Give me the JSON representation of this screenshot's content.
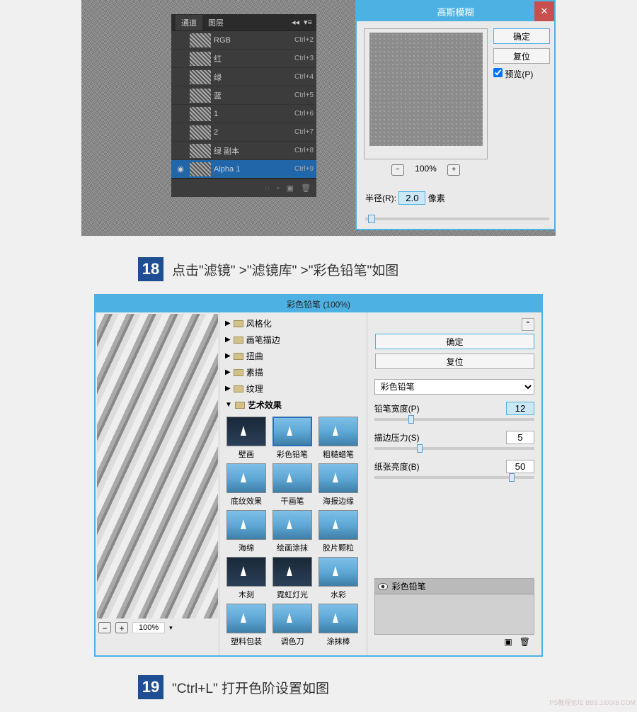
{
  "channels": {
    "tabs": [
      {
        "label": "通道"
      },
      {
        "label": "图层"
      }
    ],
    "rows": [
      {
        "name": "RGB",
        "shortcut": "Ctrl+2",
        "eye": false
      },
      {
        "name": "红",
        "shortcut": "Ctrl+3",
        "eye": false
      },
      {
        "name": "绿",
        "shortcut": "Ctrl+4",
        "eye": false
      },
      {
        "name": "蓝",
        "shortcut": "Ctrl+5",
        "eye": false
      },
      {
        "name": "1",
        "shortcut": "Ctrl+6",
        "eye": false
      },
      {
        "name": "2",
        "shortcut": "Ctrl+7",
        "eye": false
      },
      {
        "name": "绿 副本",
        "shortcut": "Ctrl+8",
        "eye": false
      },
      {
        "name": "Alpha 1",
        "shortcut": "Ctrl+9",
        "eye": true
      }
    ]
  },
  "gaussian": {
    "title": "高斯模糊",
    "ok": "确定",
    "reset": "复位",
    "preview_label": "预览(P)",
    "zoom": "100%",
    "radius_label": "半径(R):",
    "radius_value": "2.0",
    "radius_unit": "像素"
  },
  "step18": {
    "num": "18",
    "text": "点击\"滤镜\" >\"滤镜库\" >\"彩色铅笔\"如图"
  },
  "step19": {
    "num": "19",
    "text": "\"Ctrl+L\" 打开色阶设置如图"
  },
  "filter_gallery": {
    "title": "彩色铅笔 (100%)",
    "ok": "确定",
    "reset": "复位",
    "zoom": "100%",
    "categories": [
      {
        "name": "风格化",
        "open": false
      },
      {
        "name": "画笔描边",
        "open": false
      },
      {
        "name": "扭曲",
        "open": false
      },
      {
        "name": "素描",
        "open": false
      },
      {
        "name": "纹理",
        "open": false
      },
      {
        "name": "艺术效果",
        "open": true
      }
    ],
    "thumbs": [
      {
        "name": "壁画",
        "dark": true
      },
      {
        "name": "彩色铅笔",
        "selected": true
      },
      {
        "name": "粗糙蜡笔"
      },
      {
        "name": "底纹效果"
      },
      {
        "name": "干画笔"
      },
      {
        "name": "海报边缘"
      },
      {
        "name": "海绵"
      },
      {
        "name": "绘画涂抹"
      },
      {
        "name": "胶片颗粒"
      },
      {
        "name": "木刻",
        "dark": true
      },
      {
        "name": "霓虹灯光",
        "dark": true
      },
      {
        "name": "水彩"
      },
      {
        "name": "塑料包装"
      },
      {
        "name": "调色刀"
      },
      {
        "name": "涂抹棒"
      }
    ],
    "filter_select": "彩色铅笔",
    "params": [
      {
        "label": "铅笔宽度(P)",
        "value": "12",
        "pos": 48,
        "hl": true
      },
      {
        "label": "描边压力(S)",
        "value": "5",
        "pos": 60,
        "hl": false
      },
      {
        "label": "纸张亮度(B)",
        "value": "50",
        "pos": 190,
        "hl": false
      }
    ],
    "layer_name": "彩色铅笔"
  },
  "watermark": "PS教程论坛 BBS.16XX8.COM"
}
